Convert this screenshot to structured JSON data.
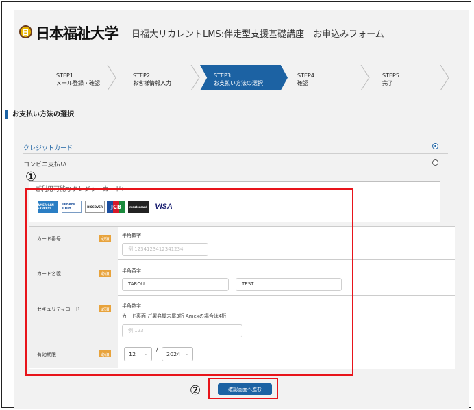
{
  "header": {
    "logo_text": "日",
    "university": "日本福祉大学",
    "course_title": "日福大リカレントLMS:伴走型支援基礎講座　お申込みフォーム"
  },
  "steps": [
    {
      "num": "STEP1",
      "label": "メール登録・確認",
      "active": false
    },
    {
      "num": "STEP2",
      "label": "お客様情報入力",
      "active": false
    },
    {
      "num": "STEP3",
      "label": "お支払い方法の選択",
      "active": true
    },
    {
      "num": "STEP4",
      "label": "確認",
      "active": false
    },
    {
      "num": "STEP5",
      "label": "完了",
      "active": false
    }
  ],
  "section_title": "お支払い方法の選択",
  "payment_options": [
    {
      "label": "クレジットカード",
      "selected": true
    },
    {
      "label": "コンビニ支払い",
      "selected": false
    }
  ],
  "cards": {
    "title": "ご利用可能なクレジットカード：",
    "logos": [
      "AMERICAN EXPRESS",
      "Diners Club",
      "DISCOVER",
      "JCB",
      "mastercard",
      "VISA"
    ]
  },
  "form": {
    "required_label": "必須",
    "card_number": {
      "label": "カード番号",
      "hint": "半角数字",
      "placeholder": "例 1234123412341234"
    },
    "card_name": {
      "label": "カード名義",
      "hint": "半角英字",
      "first": "TAROU",
      "last": "TEST"
    },
    "security_code": {
      "label": "セキュリティコード",
      "hint": "半角数字",
      "hint2": "カード裏面 ご署名欄末尾3桁 Amexの場合は4桁",
      "placeholder": "例 123"
    },
    "expiry": {
      "label": "有効期限",
      "month": "12",
      "separator": "/",
      "year": "2024"
    }
  },
  "confirm_button": "確認画面へ進む",
  "annotations": {
    "one": "①",
    "two": "②"
  },
  "colors": {
    "accent": "#1c62a3",
    "required": "#e8a33c",
    "highlight": "#e8141b"
  }
}
